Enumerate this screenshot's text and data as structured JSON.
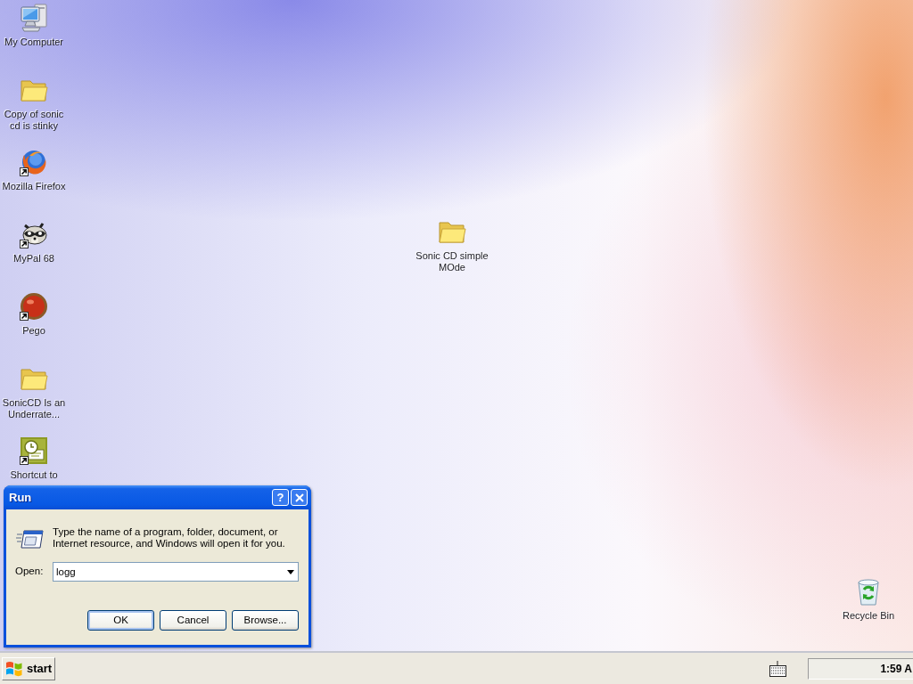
{
  "desktop": {
    "icons": [
      {
        "kind": "computer",
        "label": "My Computer",
        "shortcut": false
      },
      {
        "kind": "folder",
        "label": "Copy of sonic cd is stinky",
        "shortcut": false
      },
      {
        "kind": "firefox",
        "label": "Mozilla Firefox",
        "shortcut": true
      },
      {
        "kind": "raccoon",
        "label": "MyPal 68",
        "shortcut": true
      },
      {
        "kind": "pego",
        "label": "Pego",
        "shortcut": true
      },
      {
        "kind": "folder",
        "label": "SonicCD Is an Underrate...",
        "shortcut": false
      },
      {
        "kind": "clock_document",
        "label": "Shortcut to",
        "shortcut": true
      }
    ],
    "loose_icons": [
      {
        "kind": "folder",
        "label": "Sonic CD simple MOde",
        "shortcut": false
      },
      {
        "kind": "recycle_bin",
        "label": "Recycle Bin",
        "shortcut": false
      }
    ]
  },
  "run_dialog": {
    "title": "Run",
    "help_button": "?",
    "prompt": "Type the name of a program, folder, document, or Internet resource, and Windows will open it for you.",
    "open_label": "Open:",
    "open_value": "logg",
    "buttons": [
      {
        "label": "OK",
        "default": true
      },
      {
        "label": "Cancel",
        "default": false
      },
      {
        "label": "Browse...",
        "default": false
      }
    ]
  },
  "taskbar": {
    "start_button": "start",
    "clock": "1:59 A"
  }
}
